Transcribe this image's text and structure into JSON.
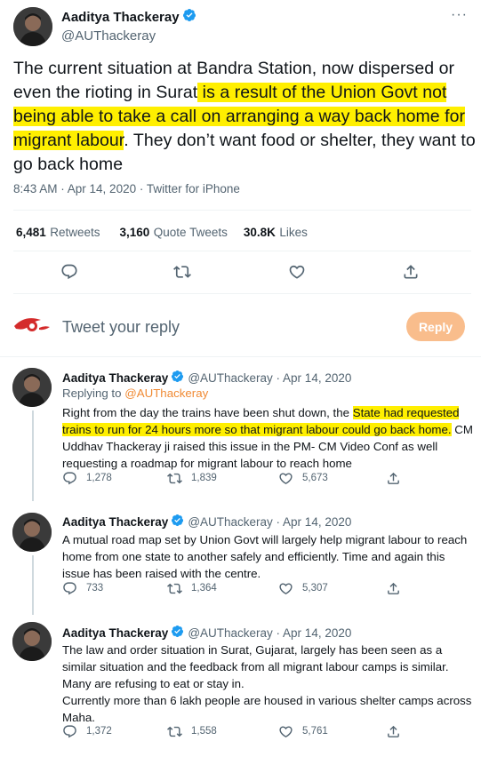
{
  "main_tweet": {
    "author_name": "Aaditya Thackeray",
    "author_handle": "@AUThackeray",
    "more_menu": "···",
    "text_before": "The current situation at Bandra Station, now dispersed or even the rioting in Surat",
    "text_highlight": " is a result of the Union Govt not being able to take a call on arranging a way back home for migrant labour",
    "text_after": ". They don’t want food or shelter, they want to go back home",
    "time": "8:43 AM · Apr 14, 2020 · Twitter for iPhone",
    "stats": {
      "retweets_num": "6,481",
      "retweets_lbl": "Retweets",
      "quotes_num": "3,160",
      "quotes_lbl": "Quote Tweets",
      "likes_num": "30.8K",
      "likes_lbl": "Likes"
    }
  },
  "composer": {
    "placeholder": "Tweet your reply",
    "button": "Reply"
  },
  "replies": [
    {
      "author_name": "Aaditya Thackeray",
      "author_handle": "@AUThackeray · Apr 14, 2020",
      "replying_prefix": "Replying to ",
      "replying_to": "@AUThackeray",
      "text_before": "Right from the day the trains have been shut down, the ",
      "text_highlight": "State had requested trains to run for 24 hours more so that migrant labour could go back home.",
      "text_after": " CM Uddhav Thackeray ji raised this issue in the PM- CM Video Conf as well requesting a roadmap for migrant labour to reach home",
      "replies": "1,278",
      "retweets": "1,839",
      "likes": "5,673"
    },
    {
      "author_name": "Aaditya Thackeray",
      "author_handle": "@AUThackeray · Apr 14, 2020",
      "text": "A mutual road map set by Union Govt will largely help migrant labour to reach home from one state to another safely and efficiently. Time and again this issue has been raised with the centre.",
      "replies": "733",
      "retweets": "1,364",
      "likes": "5,307"
    },
    {
      "author_name": "Aaditya Thackeray",
      "author_handle": "@AUThackeray · Apr 14, 2020",
      "text_line1": "The law and order situation in Surat, Gujarat, largely has been seen as a similar situation and the feedback from all migrant labour camps is similar. Many are refusing to eat or stay in.",
      "text_line2": "Currently more than 6 lakh people are housed in various shelter camps across Maha.",
      "replies": "1,372",
      "retweets": "1,558",
      "likes": "5,761"
    }
  ],
  "colors": {
    "verified": "#1d9bf0",
    "highlight": "#ffef00",
    "reply_button": "#f9bd8c",
    "link": "#f08a34",
    "muted": "#536471"
  },
  "icons": [
    "verified-badge-icon",
    "more-icon",
    "reply-icon",
    "retweet-icon",
    "like-icon",
    "share-icon",
    "logo-icon"
  ]
}
